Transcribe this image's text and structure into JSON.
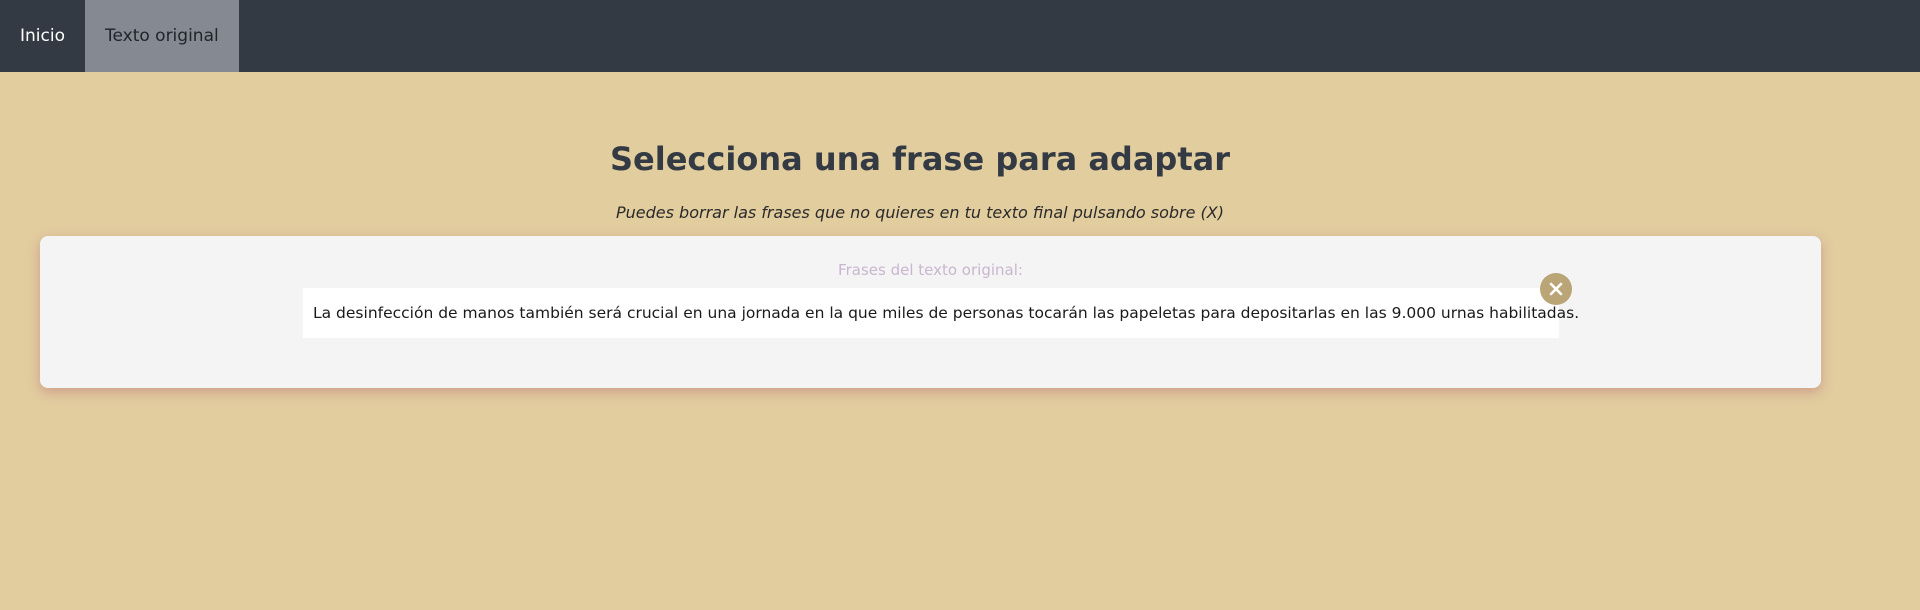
{
  "nav": {
    "items": [
      {
        "label": "Inicio",
        "active": false
      },
      {
        "label": "Texto original",
        "active": true
      }
    ]
  },
  "main": {
    "title": "Selecciona una frase para adaptar",
    "subtitle": "Puedes borrar las frases que no quieres en tu texto final pulsando sobre (X)"
  },
  "card": {
    "label": "Frases del texto original:",
    "sentences": [
      "La desinfección de manos también será crucial en una jornada en la que miles de personas tocarán las papeletas para depositarlas en las 9.000 urnas habilitadas."
    ],
    "close_icon": "close-icon"
  },
  "colors": {
    "background": "#e2cd9f",
    "navbar": "#343a43",
    "nav_active": "#858992",
    "card": "#f5f4f5",
    "close_button": "#b9a576",
    "label_text": "#c9b6cf"
  }
}
